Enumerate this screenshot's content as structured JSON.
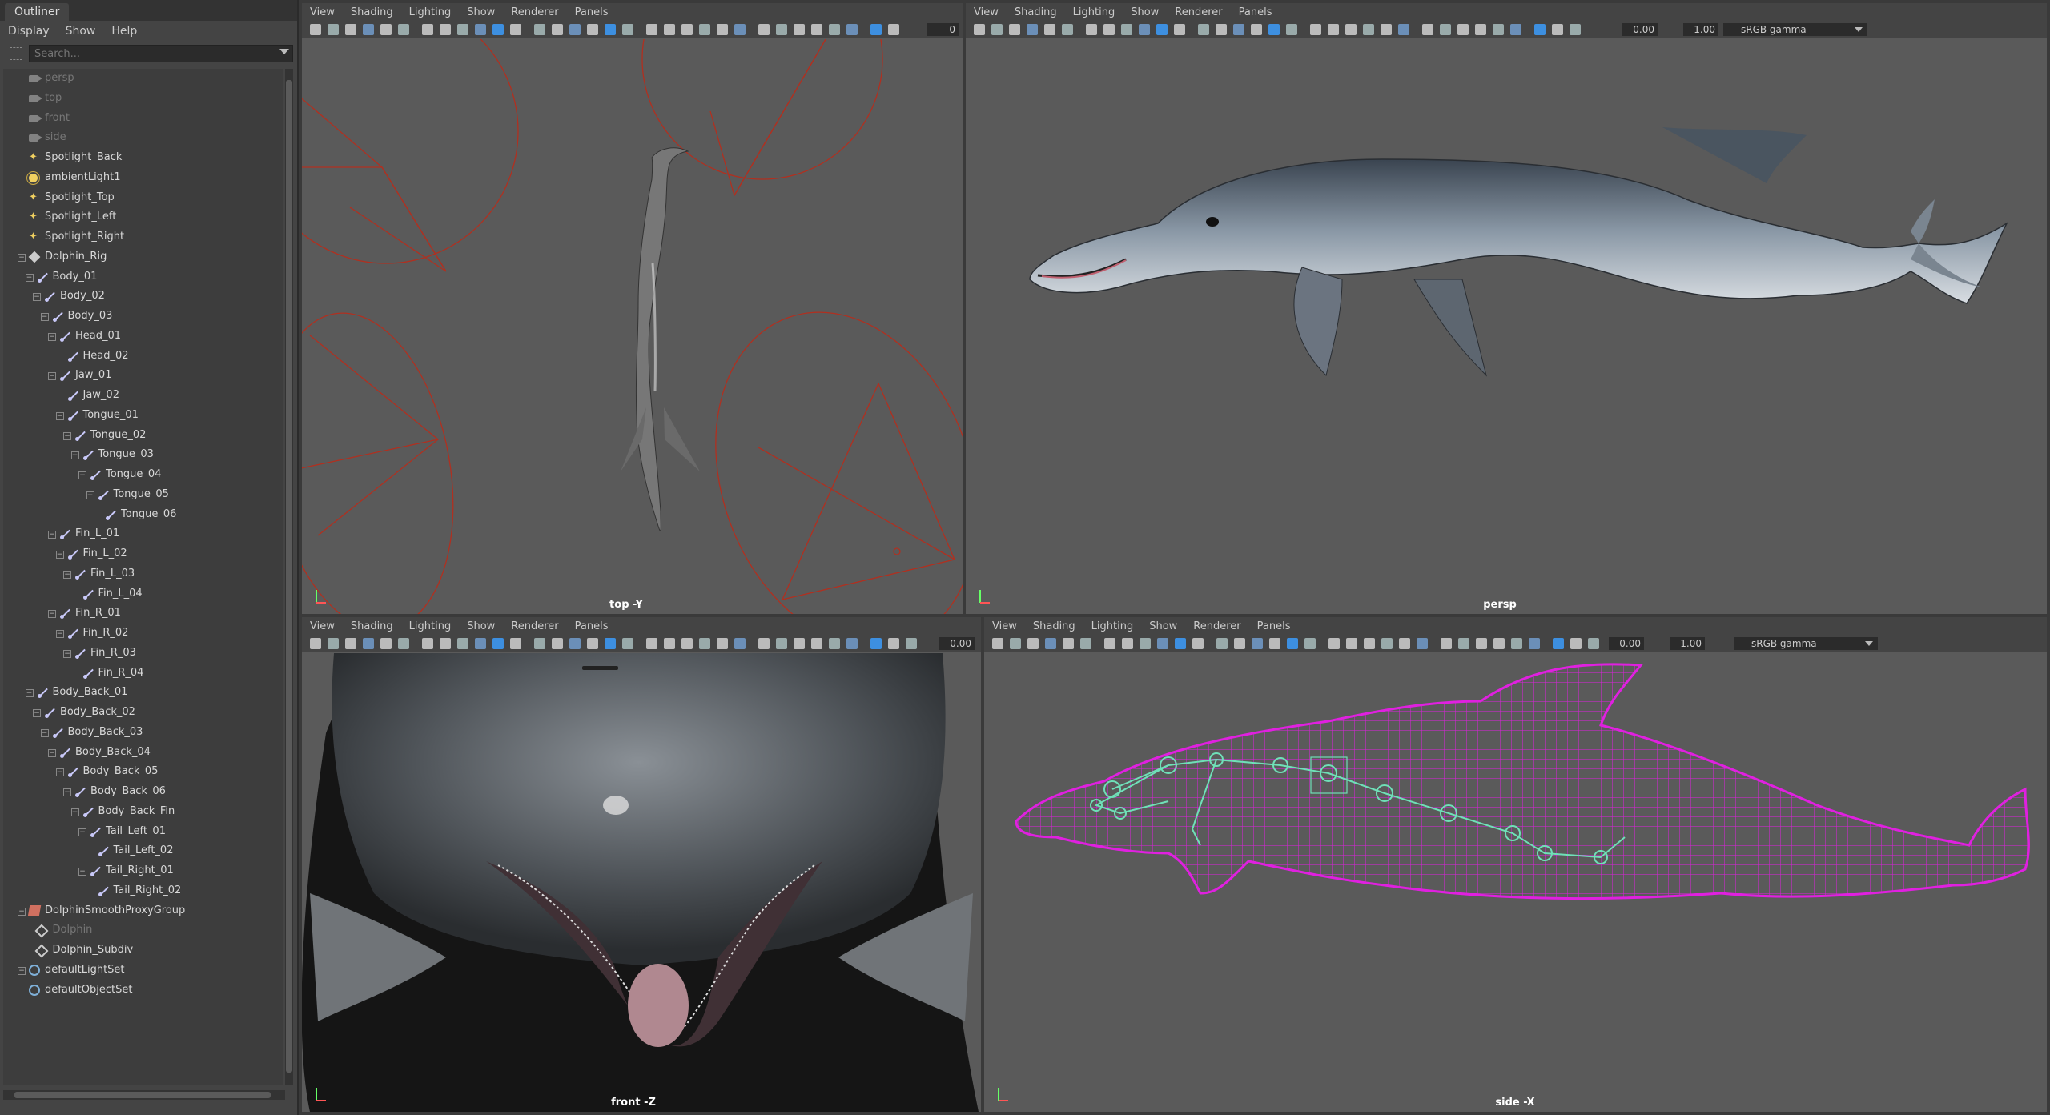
{
  "outliner": {
    "tab": "Outliner",
    "menu": [
      "Display",
      "Show",
      "Help"
    ],
    "search_placeholder": "Search...",
    "items": [
      {
        "label": "persp",
        "icon": "camera-icon",
        "depth": 0,
        "dim": true
      },
      {
        "label": "top",
        "icon": "camera-icon",
        "depth": 0,
        "dim": true
      },
      {
        "label": "front",
        "icon": "camera-icon",
        "depth": 0,
        "dim": true
      },
      {
        "label": "side",
        "icon": "camera-icon",
        "depth": 0,
        "dim": true
      },
      {
        "label": "Spotlight_Back",
        "icon": "spotlight-icon",
        "depth": 0
      },
      {
        "label": "ambientLight1",
        "icon": "ambient-light-icon",
        "depth": 0
      },
      {
        "label": "Spotlight_Top",
        "icon": "spotlight-icon",
        "depth": 0
      },
      {
        "label": "Spotlight_Left",
        "icon": "spotlight-icon",
        "depth": 0
      },
      {
        "label": "Spotlight_Right",
        "icon": "spotlight-icon",
        "depth": 0
      },
      {
        "label": "Dolphin_Rig",
        "icon": "group-icon",
        "depth": 0,
        "expand": true
      },
      {
        "label": "Body_01",
        "icon": "joint-icon",
        "depth": 1,
        "expand": true
      },
      {
        "label": "Body_02",
        "icon": "joint-icon",
        "depth": 2,
        "expand": true
      },
      {
        "label": "Body_03",
        "icon": "joint-icon",
        "depth": 3,
        "expand": true
      },
      {
        "label": "Head_01",
        "icon": "joint-icon",
        "depth": 4,
        "expand": true
      },
      {
        "label": "Head_02",
        "icon": "joint-icon",
        "depth": 5
      },
      {
        "label": "Jaw_01",
        "icon": "joint-icon",
        "depth": 4,
        "expand": true
      },
      {
        "label": "Jaw_02",
        "icon": "joint-icon",
        "depth": 5
      },
      {
        "label": "Tongue_01",
        "icon": "joint-icon",
        "depth": 5,
        "expand": true
      },
      {
        "label": "Tongue_02",
        "icon": "joint-icon",
        "depth": 6,
        "expand": true
      },
      {
        "label": "Tongue_03",
        "icon": "joint-icon",
        "depth": 7,
        "expand": true
      },
      {
        "label": "Tongue_04",
        "icon": "joint-icon",
        "depth": 8,
        "expand": true
      },
      {
        "label": "Tongue_05",
        "icon": "joint-icon",
        "depth": 9,
        "expand": true
      },
      {
        "label": "Tongue_06",
        "icon": "joint-icon",
        "depth": 10
      },
      {
        "label": "Fin_L_01",
        "icon": "joint-icon",
        "depth": 4,
        "expand": true
      },
      {
        "label": "Fin_L_02",
        "icon": "joint-icon",
        "depth": 5,
        "expand": true
      },
      {
        "label": "Fin_L_03",
        "icon": "joint-icon",
        "depth": 6,
        "expand": true
      },
      {
        "label": "Fin_L_04",
        "icon": "joint-icon",
        "depth": 7
      },
      {
        "label": "Fin_R_01",
        "icon": "joint-icon",
        "depth": 4,
        "expand": true
      },
      {
        "label": "Fin_R_02",
        "icon": "joint-icon",
        "depth": 5,
        "expand": true
      },
      {
        "label": "Fin_R_03",
        "icon": "joint-icon",
        "depth": 6,
        "expand": true
      },
      {
        "label": "Fin_R_04",
        "icon": "joint-icon",
        "depth": 7
      },
      {
        "label": "Body_Back_01",
        "icon": "joint-icon",
        "depth": 1,
        "expand": true
      },
      {
        "label": "Body_Back_02",
        "icon": "joint-icon",
        "depth": 2,
        "expand": true
      },
      {
        "label": "Body_Back_03",
        "icon": "joint-icon",
        "depth": 3,
        "expand": true
      },
      {
        "label": "Body_Back_04",
        "icon": "joint-icon",
        "depth": 4,
        "expand": true
      },
      {
        "label": "Body_Back_05",
        "icon": "joint-icon",
        "depth": 5,
        "expand": true
      },
      {
        "label": "Body_Back_06",
        "icon": "joint-icon",
        "depth": 6,
        "expand": true
      },
      {
        "label": "Body_Back_Fin",
        "icon": "joint-icon",
        "depth": 7,
        "expand": true
      },
      {
        "label": "Tail_Left_01",
        "icon": "joint-icon",
        "depth": 8,
        "expand": true
      },
      {
        "label": "Tail_Left_02",
        "icon": "joint-icon",
        "depth": 9
      },
      {
        "label": "Tail_Right_01",
        "icon": "joint-icon",
        "depth": 8,
        "expand": true
      },
      {
        "label": "Tail_Right_02",
        "icon": "joint-icon",
        "depth": 9
      },
      {
        "label": "DolphinSmoothProxyGroup",
        "icon": "proxy-group-icon",
        "depth": 0,
        "expand": true
      },
      {
        "label": "Dolphin",
        "icon": "mesh-icon",
        "depth": 1,
        "dim": true
      },
      {
        "label": "Dolphin_Subdiv",
        "icon": "mesh-icon",
        "depth": 1
      },
      {
        "label": "defaultLightSet",
        "icon": "set-icon",
        "depth": 0,
        "expand": true
      },
      {
        "label": "defaultObjectSet",
        "icon": "set-icon",
        "depth": 0
      }
    ]
  },
  "viewports": [
    {
      "id": "top",
      "menu": [
        "View",
        "Shading",
        "Lighting",
        "Show",
        "Renderer",
        "Panels"
      ],
      "label": "top -Y",
      "field_value": "0"
    },
    {
      "id": "persp",
      "menu": [
        "View",
        "Shading",
        "Lighting",
        "Show",
        "Renderer",
        "Panels"
      ],
      "label": "persp",
      "exposure": "0.00",
      "gamma_value": "1.00",
      "color_space": "sRGB gamma"
    },
    {
      "id": "front",
      "menu": [
        "View",
        "Shading",
        "Lighting",
        "Show",
        "Renderer",
        "Panels"
      ],
      "label": "front -Z",
      "exposure": "0.00"
    },
    {
      "id": "side",
      "menu": [
        "View",
        "Shading",
        "Lighting",
        "Show",
        "Renderer",
        "Panels"
      ],
      "label": "side -X",
      "exposure": "0.00",
      "gamma_value": "1.00",
      "color_space": "sRGB gamma"
    }
  ],
  "colors": {
    "viewport_bg": "#5a5a5a",
    "panel_bg": "#444444",
    "wireframe": "#e020e0",
    "joint": "#6fe0b8",
    "light_gizmo": "#b03020"
  }
}
